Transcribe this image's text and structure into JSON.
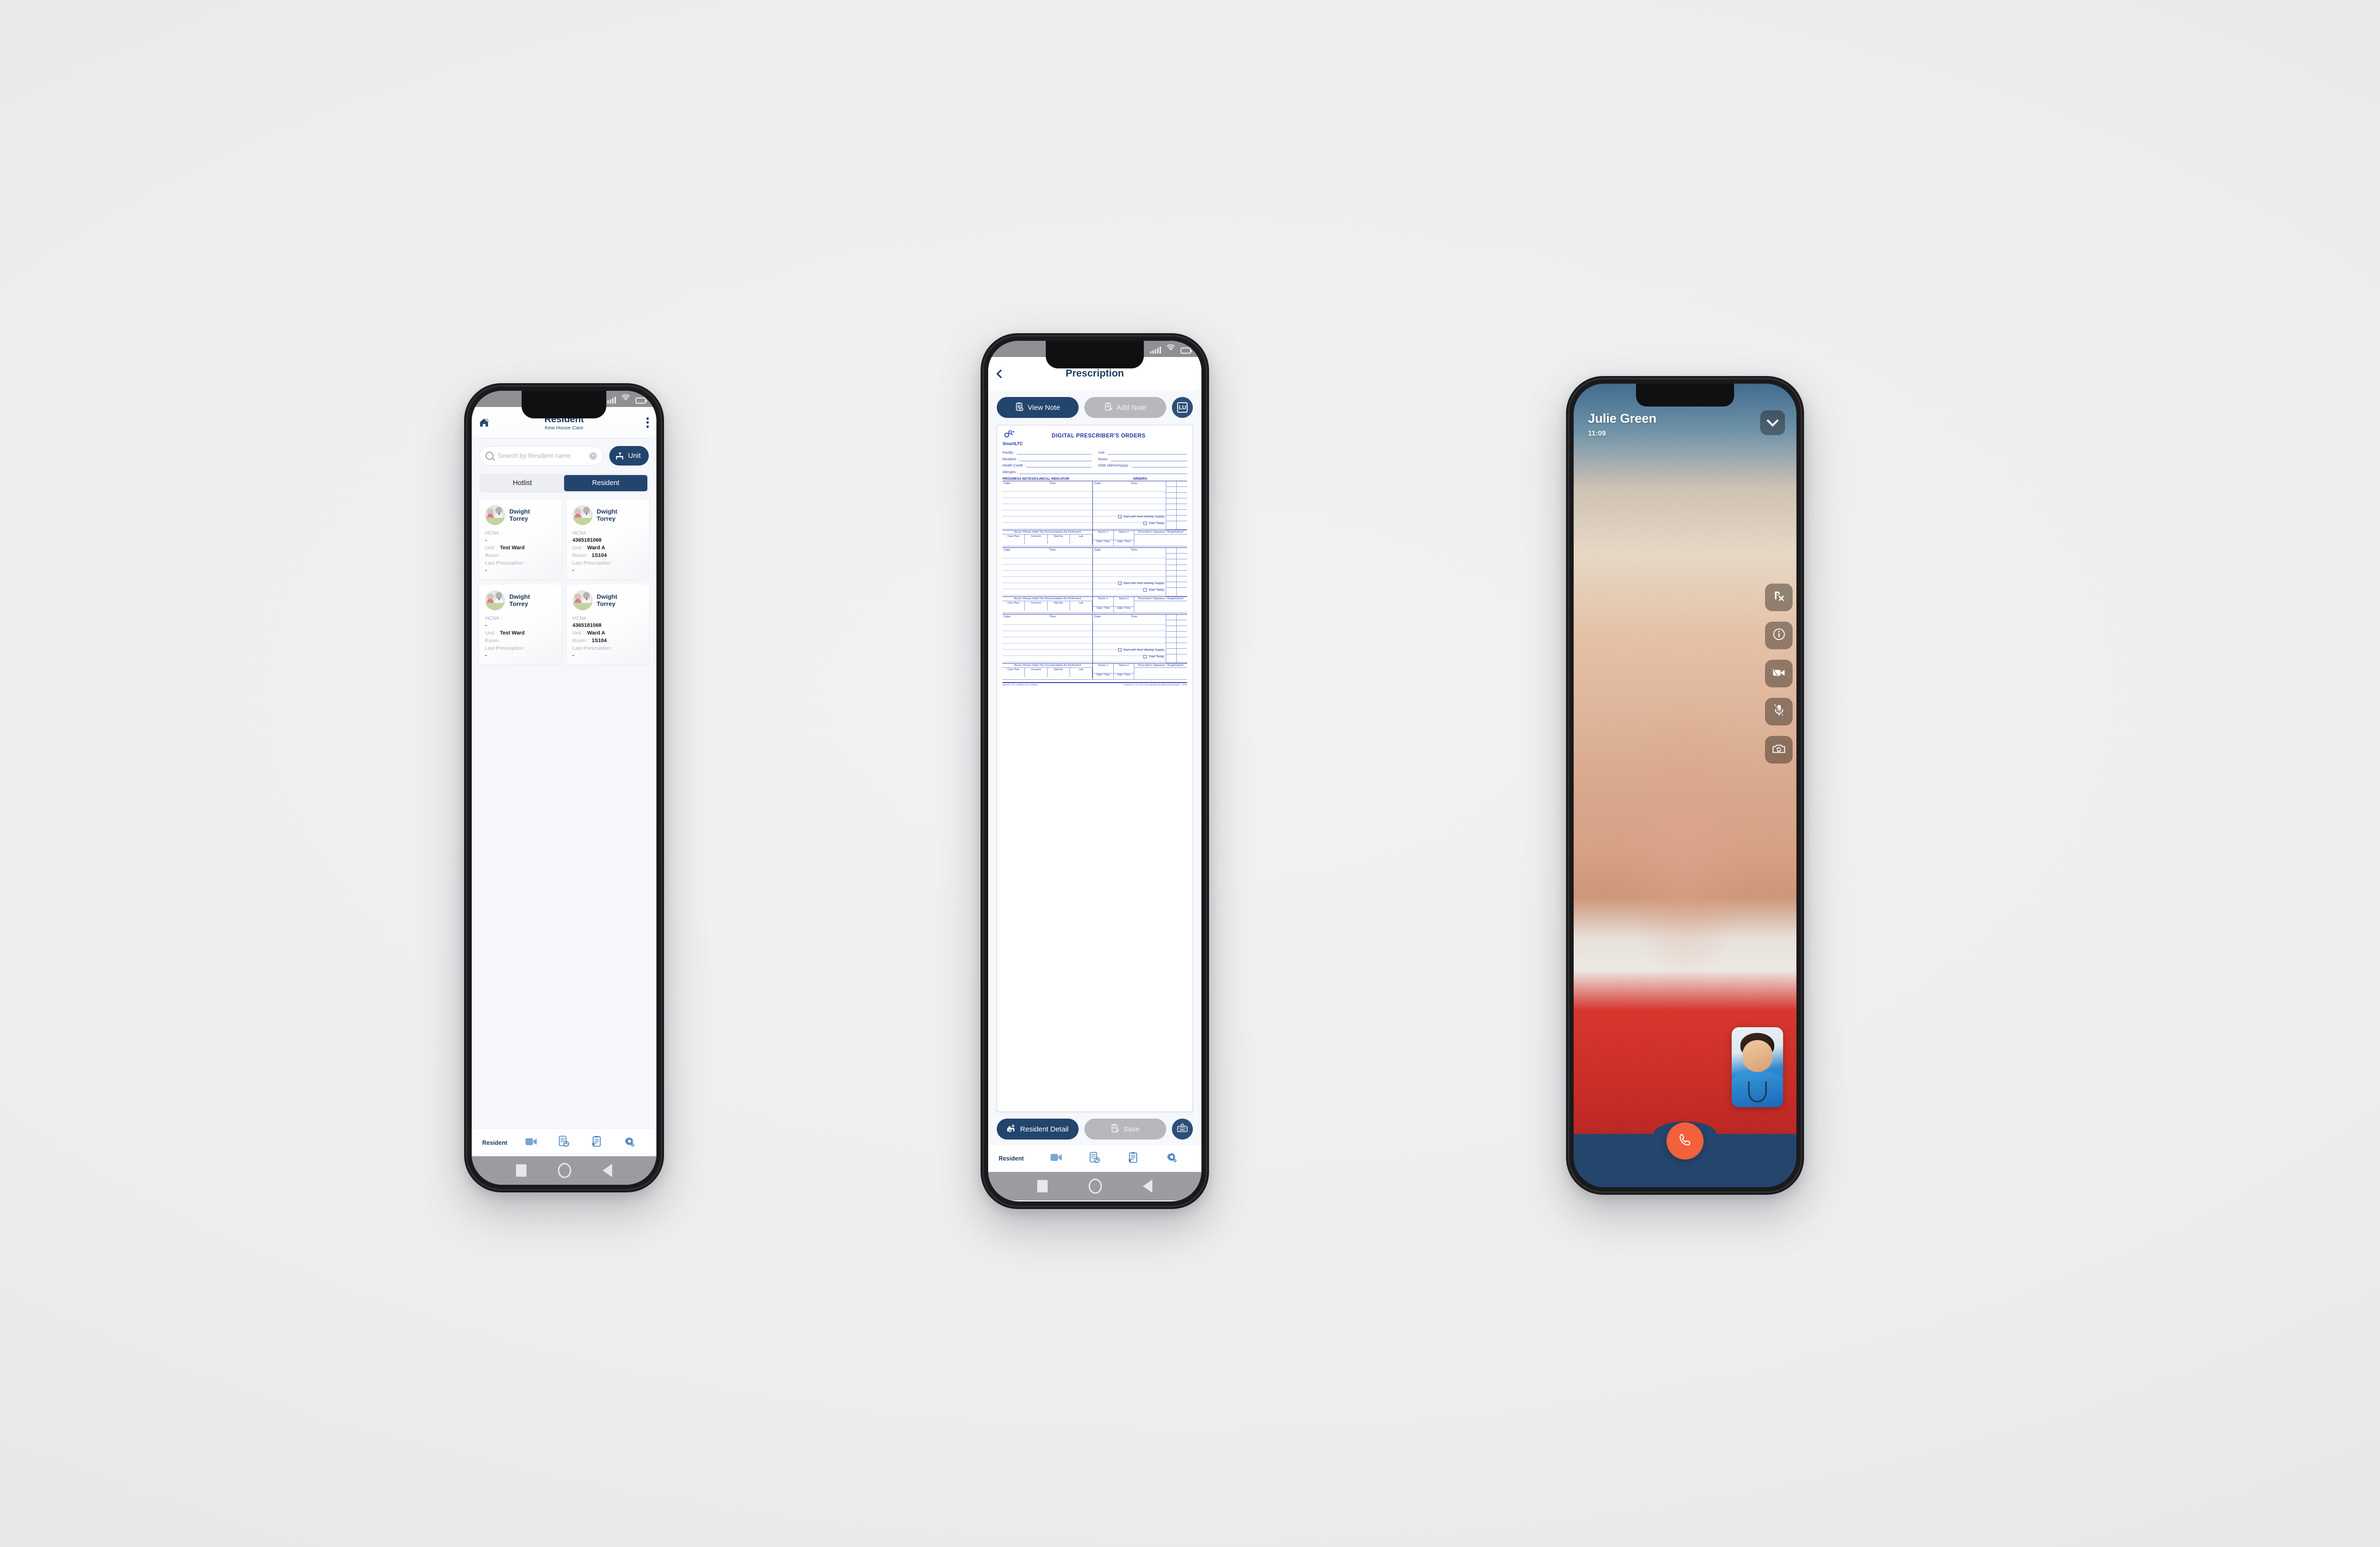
{
  "phone1": {
    "status_bar": {
      "signal": "signal-bars",
      "wifi": "wifi",
      "battery": "battery"
    },
    "header": {
      "home_icon": "home-plus-icon",
      "title": "Resident",
      "subtitle": "Kew House Care",
      "menu_icon": "kebab-menu-icon"
    },
    "search": {
      "placeholder": "Search by Resident name",
      "value": "",
      "clear_label": "×"
    },
    "unit_button": {
      "label": "Unit",
      "icon": "bed-filter-icon"
    },
    "segments": [
      {
        "label": "Hotlist",
        "active": false
      },
      {
        "label": "Resident",
        "active": true
      }
    ],
    "field_labels": {
      "hcn": "HCN# :",
      "unit": "Unit :",
      "room": "Room :",
      "last_prescription": "Last Prescription :"
    },
    "residents": [
      {
        "name_first": "Dwight",
        "name_last": "Torrey",
        "hcn": "-",
        "unit": "Test Ward",
        "room": "",
        "last_prescription": "-"
      },
      {
        "name_first": "Dwight",
        "name_last": "Torrey",
        "hcn": "4365181068",
        "unit": "Ward A",
        "room": "1S104",
        "last_prescription": "-"
      },
      {
        "name_first": "Dwight",
        "name_last": "Torrey",
        "hcn": "-",
        "unit": "Test Ward",
        "room": "",
        "last_prescription": "-"
      },
      {
        "name_first": "Dwight",
        "name_last": "Torrey",
        "hcn": "4365181068",
        "unit": "Ward A",
        "room": "1S104",
        "last_prescription": "-"
      }
    ],
    "tabbar": {
      "active_label": "Resident",
      "items": [
        "resident-tab",
        "video-call-icon",
        "prescription-request-icon",
        "orders-clipboard-icon",
        "settings-gear-icon"
      ]
    }
  },
  "phone2": {
    "header": {
      "back_icon": "back-chevron-icon",
      "title": "Prescription"
    },
    "actions": [
      {
        "label": "View Note",
        "icon": "clipboard-view-icon",
        "state": "primary"
      },
      {
        "label": "Add Note",
        "icon": "clipboard-edit-icon",
        "state": "disabled"
      }
    ],
    "avatar_button": {
      "initials": "LU",
      "name": "user-avatar-button"
    },
    "document": {
      "logo_text_a": "Smart",
      "logo_text_b": "LTC",
      "title": "DIGITAL PRESCRIBER'S ORDERS",
      "fields": [
        {
          "label": "Facility :"
        },
        {
          "label": "Unit :"
        },
        {
          "label": "Resident :"
        },
        {
          "label": "Room :"
        },
        {
          "label": "Health Card# :"
        },
        {
          "label": "DOB",
          "hint": "(dd/mm/yyyy)",
          "suffix": ":"
        },
        {
          "label": "Allergies :"
        }
      ],
      "section_left": "PROGRESS NOTES/CLINICAL INDICATOR",
      "section_right": "ORDERS",
      "date_label": "Date:",
      "time_label": "Time:",
      "checkboxes": [
        "Start with Next Weekly Supply",
        "Start Today"
      ],
      "initials_header": "Nurse: Please Initial The Documentation As Performed",
      "initials_cells": [
        "Care Plan",
        "Consent",
        "Mar/Tar",
        "Lab"
      ],
      "nurse1": "Nurse 1",
      "nurse2": "Nurse 2",
      "date_time": "Date / Time",
      "signature": "Prescriber's Signature / Registration#",
      "footer_left": "SMART LTC FORMS FEATURING",
      "footer_right": "© SMART LTC Not to be reproduced without permission.",
      "footer_code": "DPN"
    },
    "bottom_actions": [
      {
        "label": "Resident Detail",
        "icon": "bed-info-icon",
        "state": "primary"
      },
      {
        "label": "Save",
        "icon": "clipboard-edit-icon",
        "state": "disabled"
      }
    ],
    "keyboard_button": {
      "name": "keyboard-info-button",
      "icon": "keyboard-icon"
    },
    "tabbar": {
      "active_label": "Resident",
      "items": [
        "resident-tab",
        "video-call-icon",
        "prescription-request-icon",
        "orders-clipboard-icon",
        "settings-gear-icon"
      ]
    }
  },
  "phone3": {
    "caller_name": "Julie Green",
    "call_time": "11:09",
    "collapse_button": {
      "name": "collapse-call-button",
      "icon": "chevron-down-icon"
    },
    "rail": [
      {
        "name": "prescription-rx-button",
        "icon": "rx-icon",
        "label": "Rx"
      },
      {
        "name": "call-info-button",
        "icon": "info-icon",
        "label": "i"
      },
      {
        "name": "toggle-camera-button",
        "icon": "camera-off-icon",
        "label": ""
      },
      {
        "name": "toggle-mic-button",
        "icon": "mic-off-icon",
        "label": ""
      },
      {
        "name": "switch-camera-button",
        "icon": "camera-flip-icon",
        "label": ""
      }
    ],
    "self_view": {
      "name": "self-view-pip",
      "label": "nurse-self-view"
    },
    "end_call": {
      "name": "end-call-button",
      "icon": "phone-hangup-icon"
    }
  },
  "colors": {
    "brand_navy": "#22456e",
    "brand_navy_dark": "#1e3a5f",
    "doc_blue": "#2337a8",
    "muted_gray": "#b6b8bb",
    "end_call_orange": "#f2603c",
    "call_tray_navy": "#24466d"
  }
}
